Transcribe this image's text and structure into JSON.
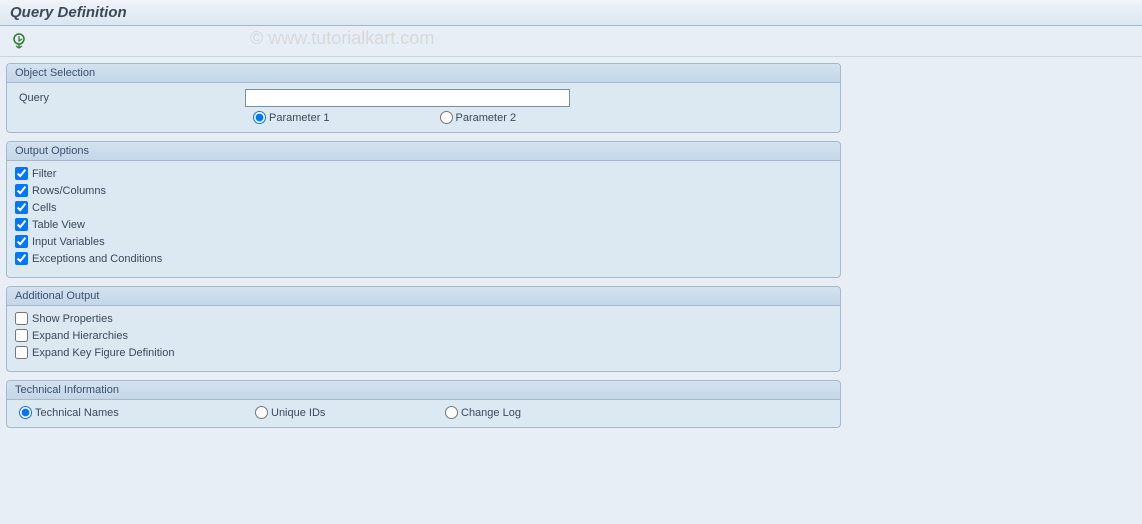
{
  "header": {
    "title": "Query Definition"
  },
  "watermark": "© www.tutorialkart.com",
  "objectSelection": {
    "title": "Object Selection",
    "queryLabel": "Query",
    "queryValue": "",
    "param1": {
      "label": "Parameter 1",
      "checked": true
    },
    "param2": {
      "label": "Parameter 2",
      "checked": false
    }
  },
  "outputOptions": {
    "title": "Output Options",
    "items": [
      {
        "label": "Filter",
        "checked": true
      },
      {
        "label": "Rows/Columns",
        "checked": true
      },
      {
        "label": "Cells",
        "checked": true
      },
      {
        "label": "Table View",
        "checked": true
      },
      {
        "label": "Input Variables",
        "checked": true
      },
      {
        "label": "Exceptions and Conditions",
        "checked": true
      }
    ]
  },
  "additionalOutput": {
    "title": "Additional Output",
    "items": [
      {
        "label": "Show Properties",
        "checked": false
      },
      {
        "label": "Expand Hierarchies",
        "checked": false
      },
      {
        "label": "Expand Key Figure Definition",
        "checked": false
      }
    ]
  },
  "technicalInfo": {
    "title": "Technical Information",
    "items": [
      {
        "label": "Technical Names",
        "checked": true
      },
      {
        "label": "Unique IDs",
        "checked": false
      },
      {
        "label": "Change Log",
        "checked": false
      }
    ]
  }
}
